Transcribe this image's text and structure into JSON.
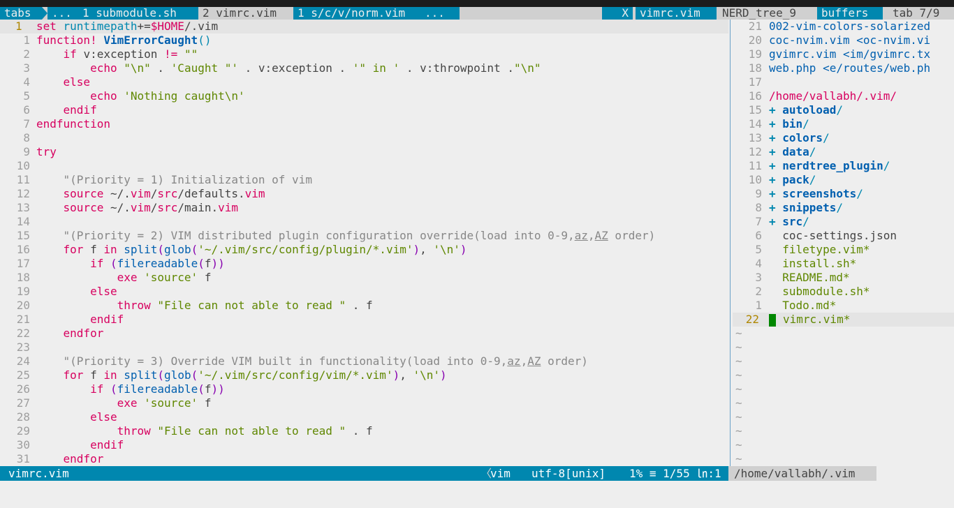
{
  "tabline": {
    "tabs_label": "tabs",
    "ellipsis_left": "...",
    "tab1": "1 submodule.sh",
    "tab2": "2 vimrc.vim",
    "tab3": "1 s/c/v/norm.vim",
    "ellipsis_right": "...",
    "close": "X",
    "buf_vimrc": "vimrc.vim",
    "buf_nerd": "NERD_tree_9",
    "buffers_label": "buffers",
    "tab_count": "tab 7/9"
  },
  "left_pane": {
    "current_line_number": "1",
    "lines": [
      {
        "n": "1",
        "cur": true,
        "parts": [
          [
            "kw",
            "set "
          ],
          [
            "var",
            "runtimepath"
          ],
          [
            "pl",
            "+="
          ],
          [
            "kw",
            "$HOME"
          ],
          [
            "pl",
            "/.vim"
          ]
        ]
      },
      {
        "n": "1",
        "parts": [
          [
            "kw",
            "function! "
          ],
          [
            "fnb",
            "VimErrorCaught"
          ],
          [
            "var",
            "()"
          ]
        ]
      },
      {
        "n": "2",
        "parts": [
          [
            "pl",
            "    "
          ],
          [
            "kw",
            "if "
          ],
          [
            "pl",
            "v:exception "
          ],
          [
            "kw",
            "!= "
          ],
          [
            "str",
            "\"\""
          ]
        ]
      },
      {
        "n": "3",
        "parts": [
          [
            "pl",
            "        "
          ],
          [
            "kw",
            "echo "
          ],
          [
            "str",
            "\"\\n\""
          ],
          [
            "pl",
            " . "
          ],
          [
            "str",
            "'Caught \"'"
          ],
          [
            "pl",
            " . v:exception . "
          ],
          [
            "str",
            "'\" in '"
          ],
          [
            "pl",
            " . v:throwpoint ."
          ],
          [
            "str",
            "\"\\n\""
          ]
        ]
      },
      {
        "n": "4",
        "parts": [
          [
            "pl",
            "    "
          ],
          [
            "kw",
            "else"
          ]
        ]
      },
      {
        "n": "5",
        "parts": [
          [
            "pl",
            "        "
          ],
          [
            "kw",
            "echo "
          ],
          [
            "str",
            "'Nothing caught\\n'"
          ]
        ]
      },
      {
        "n": "6",
        "parts": [
          [
            "pl",
            "    "
          ],
          [
            "kw",
            "endif"
          ]
        ]
      },
      {
        "n": "7",
        "parts": [
          [
            "kw",
            "endfunction"
          ]
        ]
      },
      {
        "n": "8",
        "parts": []
      },
      {
        "n": "9",
        "parts": [
          [
            "kw",
            "try"
          ]
        ]
      },
      {
        "n": "10",
        "parts": []
      },
      {
        "n": "11",
        "parts": [
          [
            "pl",
            "    "
          ],
          [
            "cm",
            "\"(Priority = 1) Initialization of vim"
          ]
        ]
      },
      {
        "n": "12",
        "parts": [
          [
            "pl",
            "    "
          ],
          [
            "kw",
            "source "
          ],
          [
            "pl",
            "~/."
          ],
          [
            "kw",
            "vim"
          ],
          [
            "pl",
            "/"
          ],
          [
            "kw",
            "src"
          ],
          [
            "pl",
            "/defaults."
          ],
          [
            "kw",
            "vim"
          ]
        ]
      },
      {
        "n": "13",
        "parts": [
          [
            "pl",
            "    "
          ],
          [
            "kw",
            "source "
          ],
          [
            "pl",
            "~/."
          ],
          [
            "kw",
            "vim"
          ],
          [
            "pl",
            "/"
          ],
          [
            "kw",
            "src"
          ],
          [
            "pl",
            "/main."
          ],
          [
            "kw",
            "vim"
          ]
        ]
      },
      {
        "n": "14",
        "parts": []
      },
      {
        "n": "15",
        "parts": [
          [
            "pl",
            "    "
          ],
          [
            "cm",
            "\"(Priority = 2) VIM distributed plugin configuration override(load into 0-9,"
          ],
          [
            "ul",
            "az"
          ],
          [
            "cm",
            ","
          ],
          [
            "ul",
            "AZ"
          ],
          [
            "cm",
            " order)"
          ]
        ]
      },
      {
        "n": "16",
        "parts": [
          [
            "pl",
            "    "
          ],
          [
            "kw",
            "for "
          ],
          [
            "pl",
            "f "
          ],
          [
            "kw",
            "in "
          ],
          [
            "fn",
            "split"
          ],
          [
            "pur",
            "("
          ],
          [
            "fn",
            "glob"
          ],
          [
            "pur",
            "("
          ],
          [
            "str",
            "'~/.vim/src/config/plugin/*.vim'"
          ],
          [
            "pur",
            ")"
          ],
          [
            "pl",
            ", "
          ],
          [
            "str",
            "'\\n'"
          ],
          [
            "pur",
            ")"
          ]
        ]
      },
      {
        "n": "17",
        "parts": [
          [
            "pl",
            "        "
          ],
          [
            "kw",
            "if "
          ],
          [
            "pur",
            "("
          ],
          [
            "fn",
            "filereadable"
          ],
          [
            "pur",
            "("
          ],
          [
            "pl",
            "f"
          ],
          [
            "pur",
            "))"
          ]
        ]
      },
      {
        "n": "18",
        "parts": [
          [
            "pl",
            "            "
          ],
          [
            "kw",
            "exe "
          ],
          [
            "str",
            "'source'"
          ],
          [
            "pl",
            " f"
          ]
        ]
      },
      {
        "n": "19",
        "parts": [
          [
            "pl",
            "        "
          ],
          [
            "kw",
            "else"
          ]
        ]
      },
      {
        "n": "20",
        "parts": [
          [
            "pl",
            "            "
          ],
          [
            "kw",
            "throw "
          ],
          [
            "str",
            "\"File can not able to read \""
          ],
          [
            "pl",
            " . f"
          ]
        ]
      },
      {
        "n": "21",
        "parts": [
          [
            "pl",
            "        "
          ],
          [
            "kw",
            "endif"
          ]
        ]
      },
      {
        "n": "22",
        "parts": [
          [
            "pl",
            "    "
          ],
          [
            "kw",
            "endfor"
          ]
        ]
      },
      {
        "n": "23",
        "parts": []
      },
      {
        "n": "24",
        "parts": [
          [
            "pl",
            "    "
          ],
          [
            "cm",
            "\"(Priority = 3) Override VIM built in functionality(load into 0-9,"
          ],
          [
            "ul",
            "az"
          ],
          [
            "cm",
            ","
          ],
          [
            "ul",
            "AZ"
          ],
          [
            "cm",
            " order)"
          ]
        ]
      },
      {
        "n": "25",
        "parts": [
          [
            "pl",
            "    "
          ],
          [
            "kw",
            "for "
          ],
          [
            "pl",
            "f "
          ],
          [
            "kw",
            "in "
          ],
          [
            "fn",
            "split"
          ],
          [
            "pur",
            "("
          ],
          [
            "fn",
            "glob"
          ],
          [
            "pur",
            "("
          ],
          [
            "str",
            "'~/.vim/src/config/vim/*.vim'"
          ],
          [
            "pur",
            ")"
          ],
          [
            "pl",
            ", "
          ],
          [
            "str",
            "'\\n'"
          ],
          [
            "pur",
            ")"
          ]
        ]
      },
      {
        "n": "26",
        "parts": [
          [
            "pl",
            "        "
          ],
          [
            "kw",
            "if "
          ],
          [
            "pur",
            "("
          ],
          [
            "fn",
            "filereadable"
          ],
          [
            "pur",
            "("
          ],
          [
            "pl",
            "f"
          ],
          [
            "pur",
            "))"
          ]
        ]
      },
      {
        "n": "27",
        "parts": [
          [
            "pl",
            "            "
          ],
          [
            "kw",
            "exe "
          ],
          [
            "str",
            "'source'"
          ],
          [
            "pl",
            " f"
          ]
        ]
      },
      {
        "n": "28",
        "parts": [
          [
            "pl",
            "        "
          ],
          [
            "kw",
            "else"
          ]
        ]
      },
      {
        "n": "29",
        "parts": [
          [
            "pl",
            "            "
          ],
          [
            "kw",
            "throw "
          ],
          [
            "str",
            "\"File can not able to read \""
          ],
          [
            "pl",
            " . f"
          ]
        ]
      },
      {
        "n": "30",
        "parts": [
          [
            "pl",
            "        "
          ],
          [
            "kw",
            "endif"
          ]
        ]
      },
      {
        "n": "31",
        "parts": [
          [
            "pl",
            "    "
          ],
          [
            "kw",
            "endfor"
          ]
        ]
      }
    ]
  },
  "right_pane": {
    "lines": [
      {
        "n": "21",
        "kind": "file",
        "text": "002-vim-colors-solarized"
      },
      {
        "n": "20",
        "kind": "file",
        "text": "coc-nvim.vim <oc-nvim.vi"
      },
      {
        "n": "19",
        "kind": "file",
        "text": "gvimrc.vim <im/gvimrc.tx"
      },
      {
        "n": "18",
        "kind": "file",
        "text": "web.php <e/routes/web.ph"
      },
      {
        "n": "17",
        "kind": "blank",
        "text": ""
      },
      {
        "n": "16",
        "kind": "path",
        "text": "/home/vallabh/.vim/"
      },
      {
        "n": "15",
        "kind": "dir",
        "text": "autoload"
      },
      {
        "n": "14",
        "kind": "dir",
        "text": "bin"
      },
      {
        "n": "13",
        "kind": "dir",
        "text": "colors"
      },
      {
        "n": "12",
        "kind": "dir",
        "text": "data"
      },
      {
        "n": "11",
        "kind": "dir",
        "text": "nerdtree_plugin"
      },
      {
        "n": "10",
        "kind": "dir",
        "text": "pack"
      },
      {
        "n": "9",
        "kind": "dir",
        "text": "screenshots"
      },
      {
        "n": "8",
        "kind": "dir",
        "text": "snippets"
      },
      {
        "n": "7",
        "kind": "dir",
        "text": "src"
      },
      {
        "n": "6",
        "kind": "plainfile",
        "text": "coc-settings.json"
      },
      {
        "n": "5",
        "kind": "exe",
        "text": "filetype.vim*"
      },
      {
        "n": "4",
        "kind": "exe",
        "text": "install.sh*"
      },
      {
        "n": "3",
        "kind": "exe",
        "text": "README.md*"
      },
      {
        "n": "2",
        "kind": "exe",
        "text": "submodule.sh*"
      },
      {
        "n": "1",
        "kind": "exe",
        "text": "Todo.md*"
      },
      {
        "n": "22",
        "kind": "curexe",
        "text": "vimrc.vim*"
      }
    ],
    "tilde": "~",
    "tilde_count": 10
  },
  "statusline": {
    "filename": "vimrc.vim",
    "filetype": "vim",
    "encoding": "utf-8[unix]",
    "position": "1% ≡ 1/55 ㏑:1",
    "tree_path": "/home/vallabh/.vim"
  },
  "colors": {
    "accent": "#0087af",
    "keyword": "#d7005f",
    "string": "#5f8700",
    "function": "#005faf"
  }
}
